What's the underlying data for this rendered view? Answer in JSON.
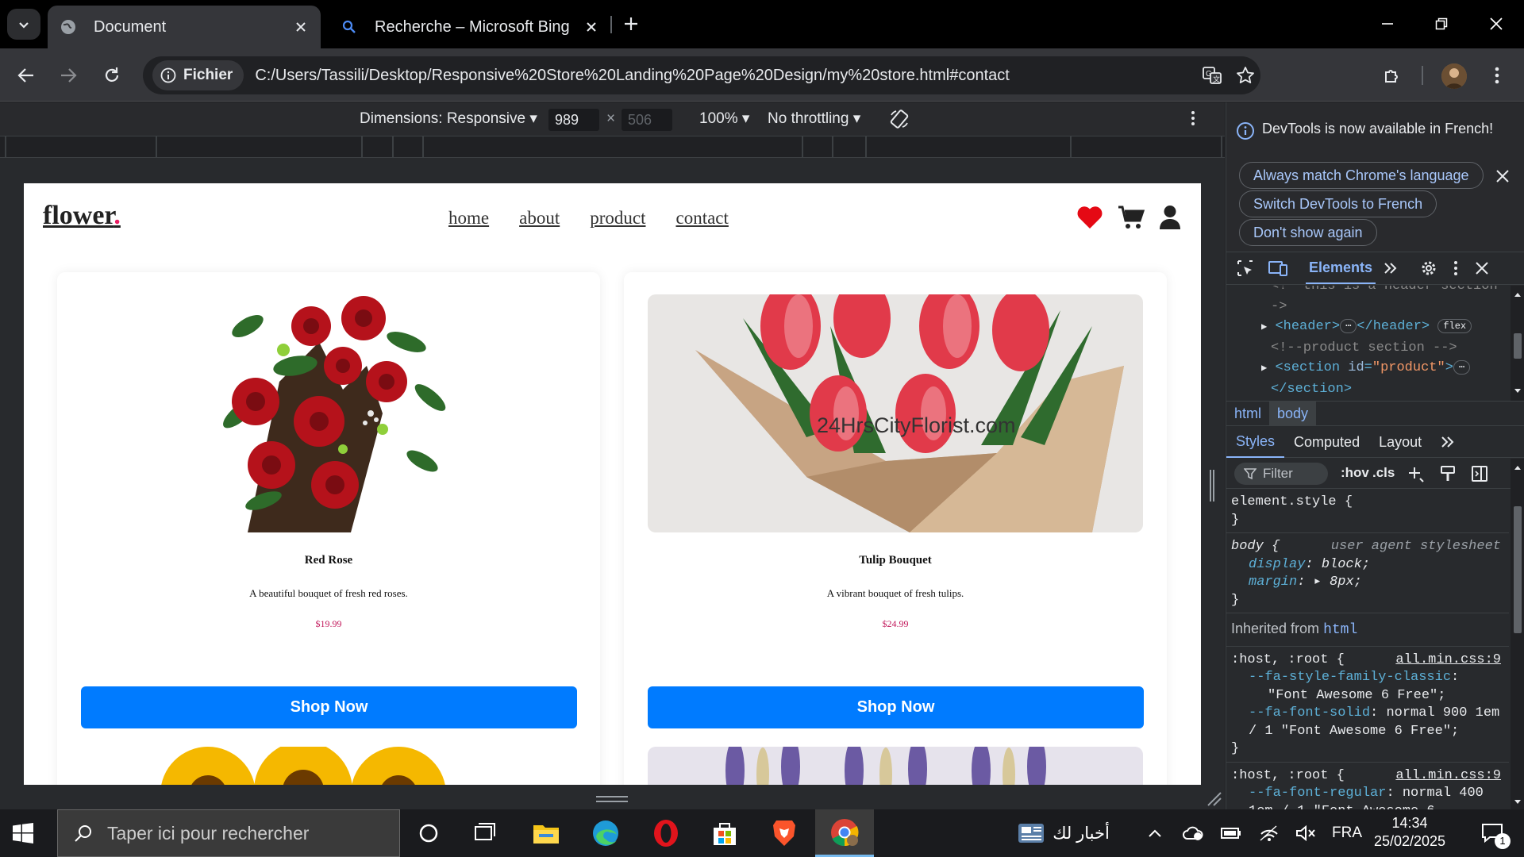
{
  "browser": {
    "tabs": [
      {
        "title": "Document",
        "active": true
      },
      {
        "title": "Recherche – Microsoft Bing",
        "active": false
      }
    ],
    "security_label": "Fichier",
    "url": "C:/Users/Tassili/Desktop/Responsive%20Store%20Landing%20Page%20Design/my%20store.html#contact"
  },
  "device_toolbar": {
    "dimensions": "Dimensions: Responsive ▾",
    "width": "989",
    "height": "506",
    "zoom": "100% ▾",
    "throttling": "No throttling ▾"
  },
  "site": {
    "logo": "flower",
    "logo_dot": ".",
    "nav": [
      "home",
      "about",
      "product",
      "contact"
    ],
    "products": [
      {
        "name": "Red Rose",
        "description": "A beautiful bouquet of fresh red roses.",
        "price": "$19.99",
        "button": "Shop Now"
      },
      {
        "name": "Tulip Bouquet",
        "description": "A vibrant bouquet of fresh tulips.",
        "price": "$24.99",
        "button": "Shop Now",
        "watermark": "24HrsCityFlorist.com"
      }
    ]
  },
  "devtools": {
    "banner": {
      "message": "DevTools is now available in French!",
      "buttons": [
        "Always match Chrome's language",
        "Switch DevTools to French",
        "Don't show again"
      ]
    },
    "active_panel": "Elements",
    "dom": {
      "comment_header": "<!--this is a header section-->",
      "comment_header_end": "->",
      "header_open": "<header>",
      "header_close": "</header>",
      "flex_badge": "flex",
      "comment_product": "<!--product section -->",
      "section_open": "<section ",
      "attr_name": "id",
      "attr_value": "\"product\"",
      "section_close": "</section>"
    },
    "breadcrumbs": [
      "html",
      "body"
    ],
    "style_tabs": [
      "Styles",
      "Computed",
      "Layout"
    ],
    "filter_placeholder": "Filter",
    "hov": ":hov",
    "cls": ".cls",
    "styles": {
      "element_style": "element.style {",
      "close_brace": "}",
      "body_selector": "body {",
      "ua_label": "user agent stylesheet",
      "body_props": [
        {
          "prop": "display",
          "value": "block;"
        },
        {
          "prop": "margin",
          "value": "▸ 8px;"
        }
      ],
      "inherited_label": "Inherited from",
      "inherited_from": "html",
      "rule1_selector": ":host, :root {",
      "rule1_source": "all.min.css:9",
      "rule1_props": [
        {
          "prop": "--fa-style-family-classic",
          "value": "\"Font Awesome 6 Free\";"
        },
        {
          "prop": "--fa-font-solid",
          "value": "normal 900 1em / 1 \"Font Awesome 6 Free\";"
        }
      ],
      "rule2_selector": ":host, :root {",
      "rule2_source": "all.min.css:9",
      "rule2_props": [
        {
          "prop": "--fa-font-regular",
          "value": "normal 400 1em / 1 \"Font Awesome 6"
        }
      ]
    }
  },
  "taskbar": {
    "search_placeholder": "Taper ici pour rechercher",
    "news": "أخبار لك",
    "language": "FRA",
    "time": "14:34",
    "date": "25/02/2025",
    "notifications": "1"
  }
}
